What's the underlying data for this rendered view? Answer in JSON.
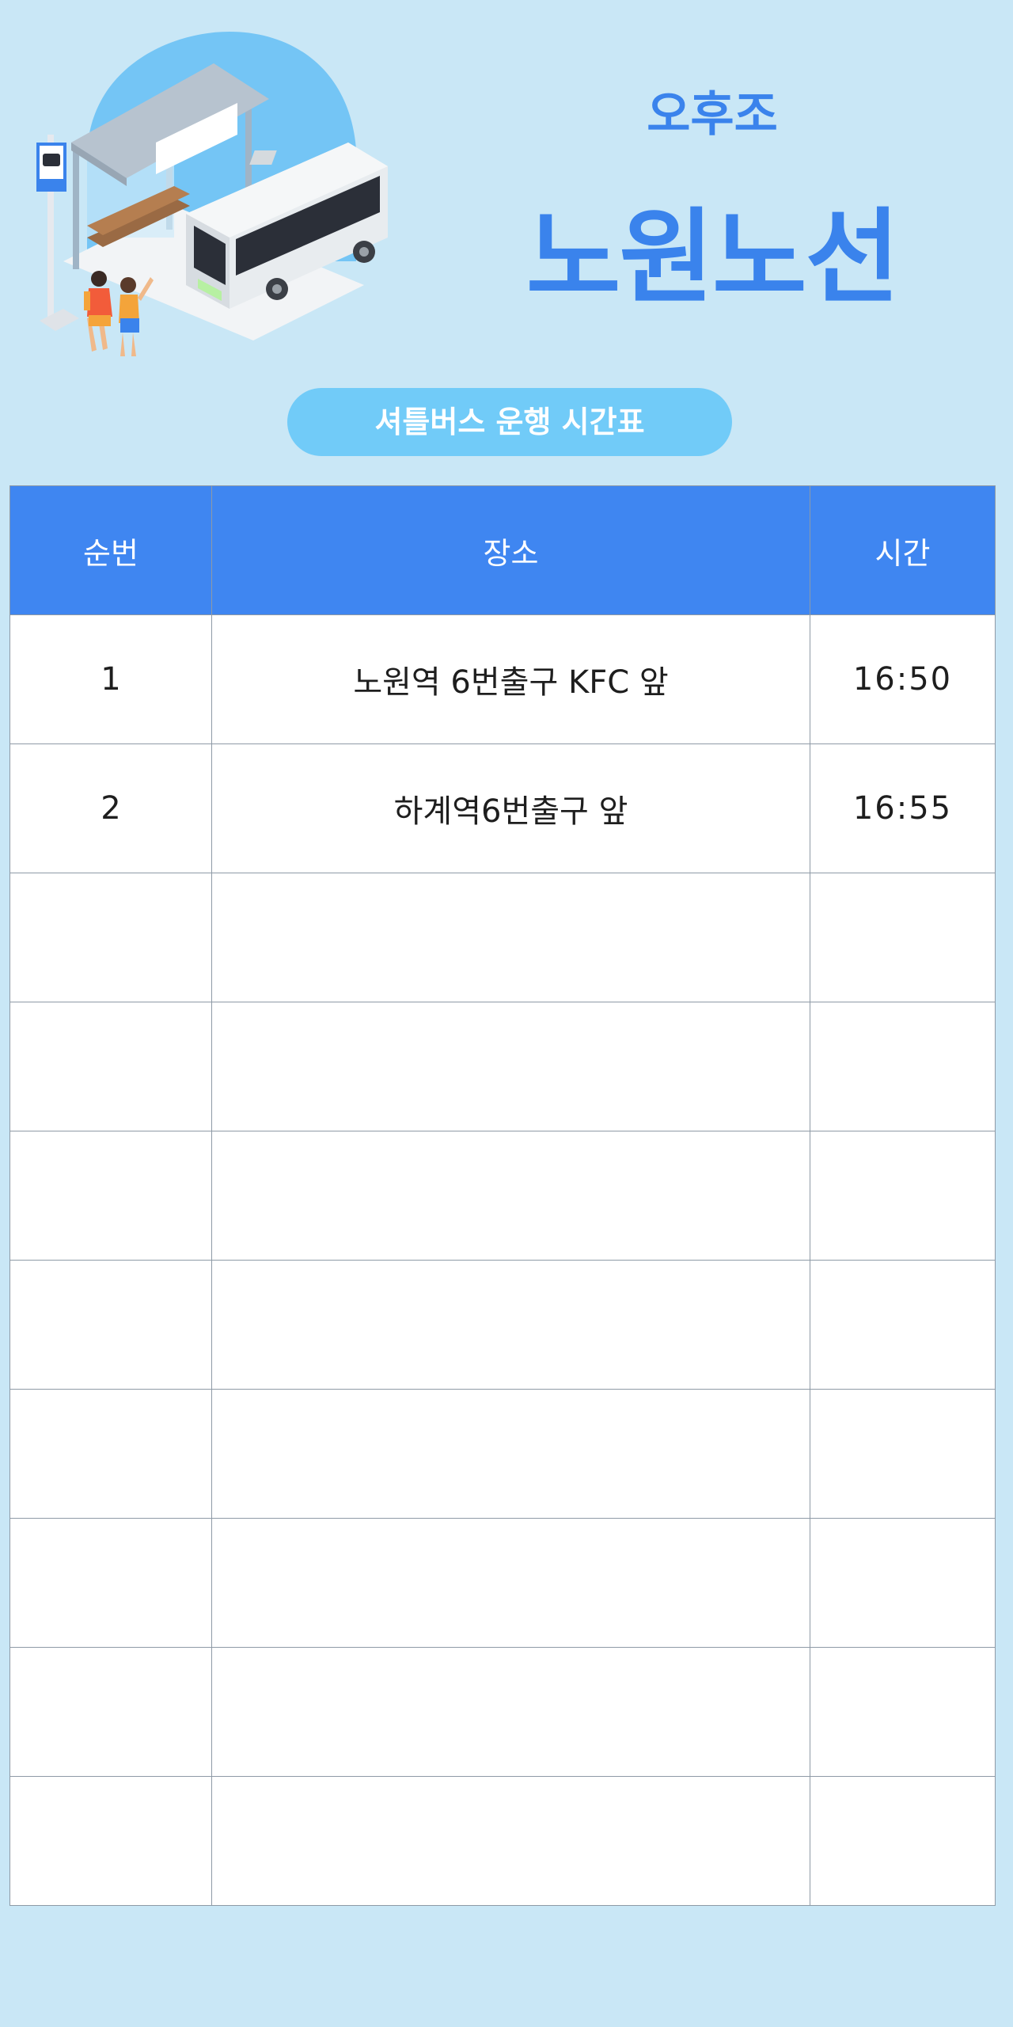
{
  "header": {
    "subtitle": "오후조",
    "title": "노원노선",
    "badge": "셔틀버스 운행 시간표"
  },
  "table": {
    "columns": [
      "순번",
      "장소",
      "시간"
    ],
    "rows": [
      {
        "num": "1",
        "place": "노원역 6번출구 KFC 앞",
        "time": "16:50"
      },
      {
        "num": "2",
        "place": "하계역6번출구 앞",
        "time": "16:55"
      },
      {
        "num": "",
        "place": "",
        "time": ""
      },
      {
        "num": "",
        "place": "",
        "time": ""
      },
      {
        "num": "",
        "place": "",
        "time": ""
      },
      {
        "num": "",
        "place": "",
        "time": ""
      },
      {
        "num": "",
        "place": "",
        "time": ""
      },
      {
        "num": "",
        "place": "",
        "time": ""
      },
      {
        "num": "",
        "place": "",
        "time": ""
      },
      {
        "num": "",
        "place": "",
        "time": ""
      }
    ]
  },
  "colors": {
    "background": "#c9e7f6",
    "accent": "#3a83ec",
    "header_bg": "#3f86f1",
    "badge_bg": "#71cbf8"
  },
  "icons": [
    "bus-stop-illustration",
    "bus-icon",
    "bus-stop-sign-icon",
    "shelter-icon",
    "people-icon"
  ]
}
